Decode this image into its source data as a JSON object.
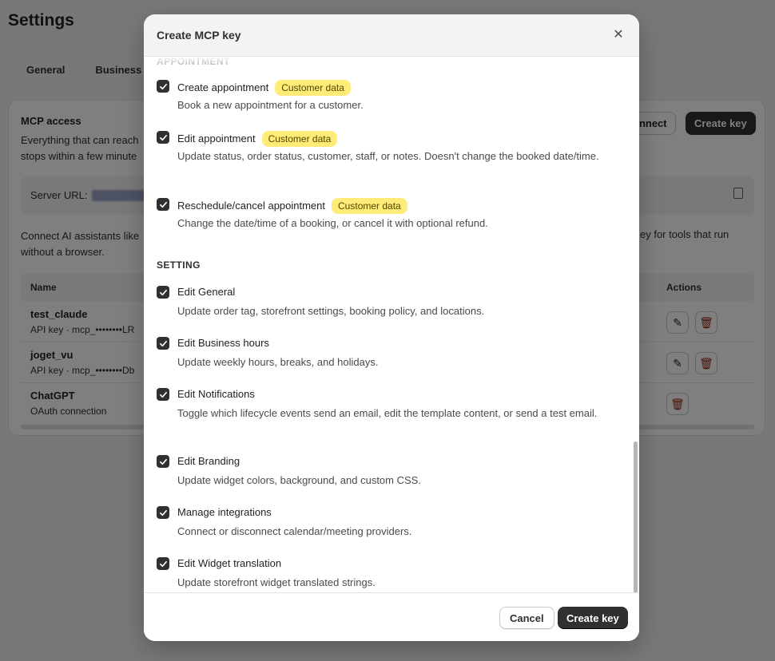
{
  "page": {
    "title": "Settings",
    "tabs": [
      "General",
      "Business hou"
    ],
    "card": {
      "title": "MCP access",
      "desc_line1": "Everything that can reach",
      "desc_line2": "stops within a few minute",
      "connect_label": "onnect",
      "create_key_label": "Create key",
      "server_url_label": "Server URL:",
      "connect_desc_line1": "Connect AI assistants like",
      "connect_desc_line2": "without a browser.",
      "connect_desc_right": "ey for tools that run",
      "table": {
        "col_name": "Name",
        "col_actions": "Actions",
        "rows": [
          {
            "name": "test_claude",
            "sub": "API key · mcp_••••••••LR"
          },
          {
            "name": "joget_vu",
            "sub": "API key · mcp_••••••••Db"
          },
          {
            "name": "ChatGPT",
            "sub": "OAuth connection"
          }
        ]
      }
    }
  },
  "modal": {
    "title": "Create MCP key",
    "sections": {
      "appointment": "APPOINTMENT",
      "setting": "SETTING"
    },
    "badge_text": "Customer data",
    "permissions": [
      {
        "label": "Create appointment",
        "desc": "Book a new appointment for a customer.",
        "badge": true
      },
      {
        "label": "Edit appointment",
        "desc": "Update status, order status, customer, staff, or notes. Doesn't change the booked date/time.",
        "badge": true
      },
      {
        "label": "Reschedule/cancel appointment",
        "desc": "Change the date/time of a booking, or cancel it with optional refund.",
        "badge": true
      },
      {
        "label": "Edit General",
        "desc": "Update order tag, storefront settings, booking policy, and locations."
      },
      {
        "label": "Edit Business hours",
        "desc": "Update weekly hours, breaks, and holidays."
      },
      {
        "label": "Edit Notifications",
        "desc": "Toggle which lifecycle events send an email, edit the template content, or send a test email."
      },
      {
        "label": "Edit Branding",
        "desc": "Update widget colors, background, and custom CSS."
      },
      {
        "label": "Manage integrations",
        "desc": "Connect or disconnect calendar/meeting providers."
      },
      {
        "label": "Edit Widget translation",
        "desc": "Update storefront widget translated strings."
      }
    ],
    "footer": {
      "cancel_label": "Cancel",
      "create_label": "Create key"
    }
  }
}
